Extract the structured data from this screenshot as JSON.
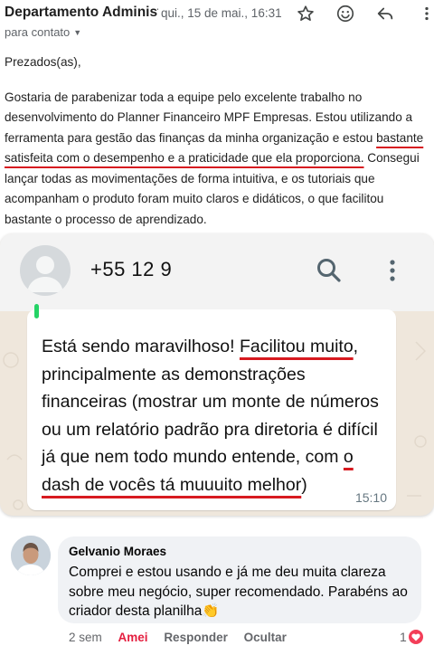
{
  "email": {
    "sender": "Departamento Administrativo",
    "date": "qui., 15 de mai., 16:31",
    "recipient": "para contato",
    "greeting": "Prezados(as),",
    "body_before": "Gostaria de parabenizar toda a equipe pelo excelente trabalho no desenvolvimento do Planner Financeiro MPF Empresas. Estou utilizando a ferramenta para gestão das finanças da minha organização e estou ",
    "body_highlight": "bastante satisfeita com o desempenho e a praticidade que ela proporciona.",
    "body_after": " Consegui lançar todas as movimentações de forma intuitiva, e os tutoriais que acompanham o produto foram muito claros e didáticos, o que facilitou bastante o processo de aprendizado.",
    "icons": [
      "star-icon",
      "smile-icon",
      "reply-icon",
      "more-vert-icon"
    ]
  },
  "whatsapp": {
    "contact": "+55 12 9",
    "message_part1": "Está sendo maravilhoso! ",
    "message_highlight1": "Facilitou muito",
    "message_part2": ", principalmente as demonstrações financeiras (mostrar um monte de números ou um relatório padrão pra diretoria é difícil já que nem todo mundo entende, com ",
    "message_highlight2": "o dash de vocês tá muuuito melhor",
    "message_part3": ")",
    "time": "15:10",
    "icons": [
      "search-icon",
      "more-vert-icon"
    ]
  },
  "facebook_comment": {
    "author": "Gelvanio Moraes",
    "text": "Comprei e estou usando e já me deu muita clareza sobre meu negócio, super recomendado. Parabéns ao criador desta planilha👏",
    "time_ago": "2 sem",
    "like_label": "Amei",
    "reply_label": "Responder",
    "hide_label": "Ocultar",
    "reaction_count": "1",
    "reaction_icon": "heart-icon"
  },
  "colors": {
    "underline": "#d71a20",
    "whatsapp_bg": "#efe7dc",
    "facebook_love": "#e41e3f"
  }
}
